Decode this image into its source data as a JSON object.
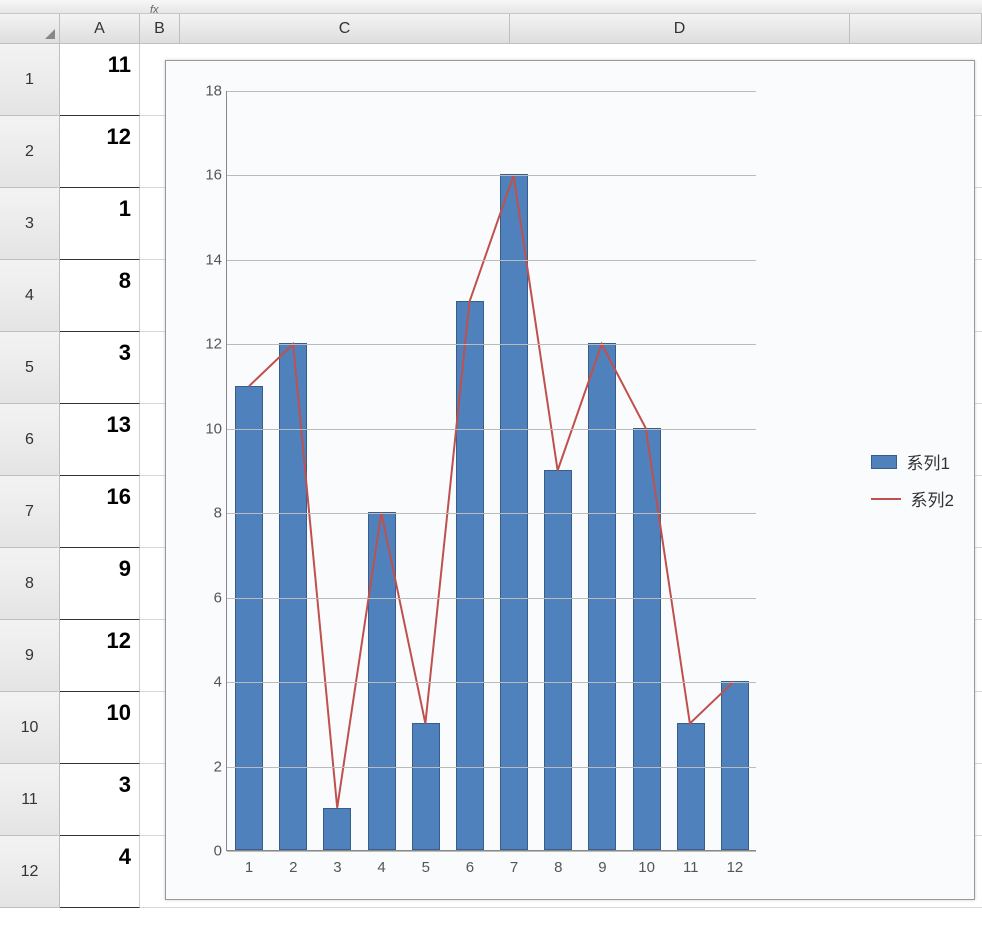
{
  "formula_bar": {
    "fx": "fx"
  },
  "columns": {
    "A": "A",
    "B": "B",
    "C": "C",
    "D": "D"
  },
  "row_headers": [
    "1",
    "2",
    "3",
    "4",
    "5",
    "6",
    "7",
    "8",
    "9",
    "10",
    "11",
    "12"
  ],
  "cells_A": [
    "11",
    "12",
    "1",
    "8",
    "3",
    "13",
    "16",
    "9",
    "12",
    "10",
    "3",
    "4"
  ],
  "chart_data": {
    "type": "bar+line",
    "categories": [
      "1",
      "2",
      "3",
      "4",
      "5",
      "6",
      "7",
      "8",
      "9",
      "10",
      "11",
      "12"
    ],
    "series": [
      {
        "name": "系列1",
        "kind": "bar",
        "values": [
          11,
          12,
          1,
          8,
          3,
          13,
          16,
          9,
          12,
          10,
          3,
          4
        ]
      },
      {
        "name": "系列2",
        "kind": "line",
        "values": [
          11,
          12,
          1,
          8,
          3,
          13,
          16,
          9,
          12,
          10,
          3,
          4
        ]
      }
    ],
    "ylim": [
      0,
      18
    ],
    "yticks": [
      0,
      2,
      4,
      6,
      8,
      10,
      12,
      14,
      16,
      18
    ],
    "xlabel": "",
    "ylabel": "",
    "title": ""
  },
  "legend": {
    "bar": "系列1",
    "line": "系列2"
  }
}
